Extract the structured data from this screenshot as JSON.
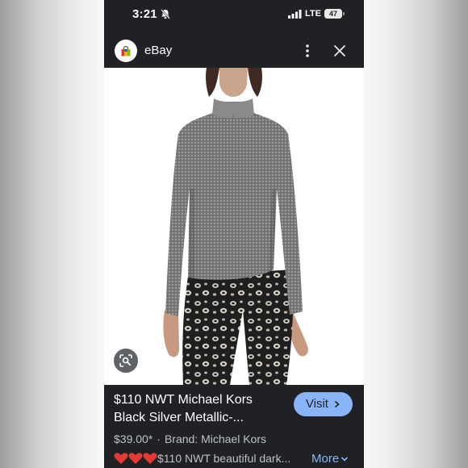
{
  "status_bar": {
    "time": "3:21",
    "network": "LTE",
    "battery": "47",
    "icons": [
      "bell-off-icon",
      "signal-icon",
      "battery-icon"
    ]
  },
  "header": {
    "app_name": "eBay",
    "icons": [
      "ebay-bag-icon",
      "more-vert-icon",
      "close-icon"
    ]
  },
  "image": {
    "icons": [
      "lens-search-icon"
    ]
  },
  "result": {
    "title": "$110 NWT Michael Kors Black Silver Metallic-...",
    "visit_label": "Visit",
    "price": "$39.00*",
    "separator": "·",
    "brand": "Brand: Michael Kors",
    "hearts": "❤️❤️❤️",
    "description": "$110 NWT beautiful dark...",
    "more_label": "More"
  },
  "colors": {
    "background": "#202124",
    "accent": "#8ab4f8",
    "heart": "#e53935"
  }
}
